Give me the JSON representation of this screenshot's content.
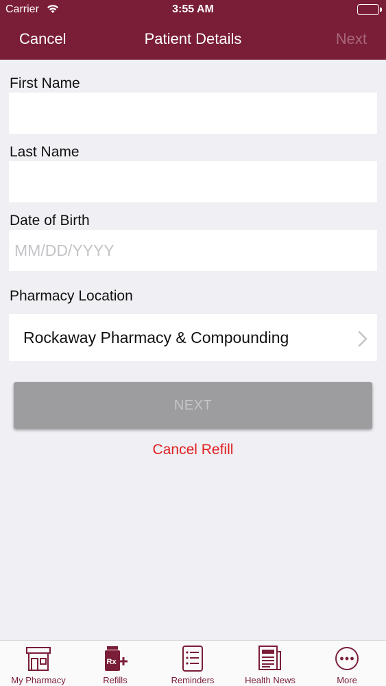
{
  "status_bar": {
    "carrier": "Carrier",
    "time": "3:55 AM"
  },
  "nav": {
    "cancel": "Cancel",
    "title": "Patient Details",
    "next": "Next"
  },
  "form": {
    "first_name_label": "First Name",
    "first_name_value": "",
    "last_name_label": "Last Name",
    "last_name_value": "",
    "dob_label": "Date of Birth",
    "dob_placeholder": "MM/DD/YYYY",
    "pharmacy_label": "Pharmacy Location",
    "pharmacy_value": "Rockaway Pharmacy & Compounding"
  },
  "actions": {
    "next_button": "NEXT",
    "cancel_refill": "Cancel Refill"
  },
  "tabs": [
    {
      "label": "My Pharmacy",
      "icon": "store-icon"
    },
    {
      "label": "Refills",
      "icon": "rx-bottle-icon"
    },
    {
      "label": "Reminders",
      "icon": "list-icon"
    },
    {
      "label": "Health News",
      "icon": "newspaper-icon"
    },
    {
      "label": "More",
      "icon": "more-icon"
    }
  ],
  "colors": {
    "brand": "#7a1e38",
    "cancel_text": "#e02020",
    "button_disabled": "#9d9d9f"
  }
}
